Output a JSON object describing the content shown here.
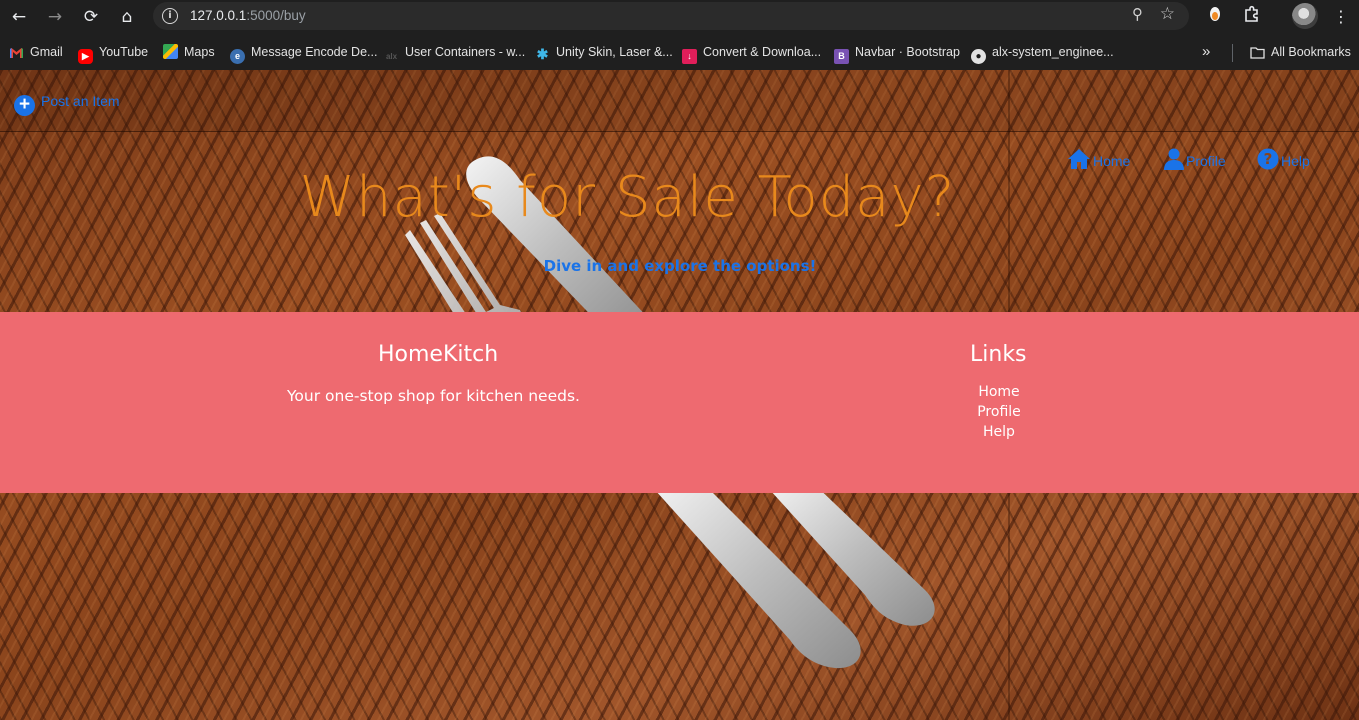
{
  "browser": {
    "url_host": "127.0.0.1",
    "url_path": ":5000/buy",
    "bookmarks": [
      {
        "label": "Gmail",
        "icon": "gmail-icon"
      },
      {
        "label": "YouTube",
        "icon": "youtube-icon"
      },
      {
        "label": "Maps",
        "icon": "maps-icon"
      },
      {
        "label": "Message Encode De...",
        "icon": "message-encode-icon"
      },
      {
        "label": "User Containers - w...",
        "icon": "alx-icon"
      },
      {
        "label": "Unity Skin, Laser &...",
        "icon": "unity-icon"
      },
      {
        "label": "Convert & Downloa...",
        "icon": "download-icon"
      },
      {
        "label": "Navbar · Bootstrap",
        "icon": "bootstrap-icon"
      },
      {
        "label": "alx-system_enginee...",
        "icon": "github-icon"
      }
    ],
    "all_bookmarks_label": "All Bookmarks",
    "overflow_label": "»"
  },
  "page": {
    "post_item_label": "Post an Item",
    "nav": {
      "home": "Home",
      "profile": "Profile",
      "help": "Help"
    },
    "hero": {
      "title": "What's for Sale Today?",
      "subtitle": "Dive in and explore the options!"
    },
    "footer": {
      "brand": "HomeKitch",
      "tagline": "Your one-stop shop for kitchen needs.",
      "links_title": "Links",
      "links": [
        "Home",
        "Profile",
        "Help"
      ]
    }
  },
  "colors": {
    "accent_blue": "#1a73e8",
    "title_orange": "#e8891c",
    "footer_bg": "#ee6a70"
  }
}
